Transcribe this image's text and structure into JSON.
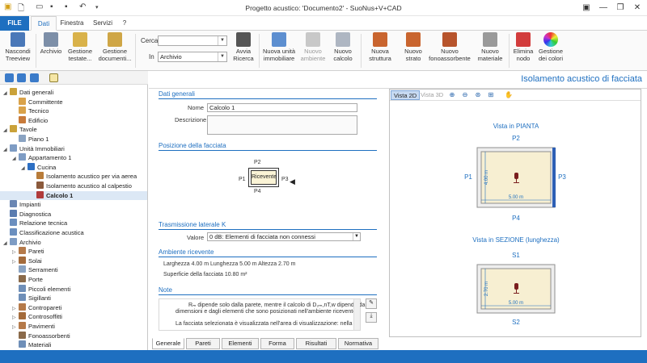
{
  "window": {
    "title": "Progetto acustico: 'Documento2' - SuoNus+V+CAD",
    "minimize": "—",
    "restore": "❐",
    "close": "✕"
  },
  "menu": {
    "file": "FILE",
    "tabs": [
      "Dati",
      "Finestra",
      "Servizi"
    ],
    "help": "?"
  },
  "ribbon": {
    "nascondi": "Nascondi Treeview",
    "archivio": "Archivio",
    "gestione_testate": "Gestione testate...",
    "gestione_documenti": "Gestione documenti...",
    "cerca_label": "Cerca",
    "cerca_value": "",
    "in_label": "In",
    "in_value": "Archivio",
    "avvia": "Avvia Ricerca",
    "nuova_unita": "Nuova unità immobiliare",
    "nuovo_ambiente": "Nuovo ambiente",
    "nuovo_calcolo": "Nuovo calcolo",
    "nuova_struttura": "Nuova struttura",
    "nuovo_strato": "Nuovo strato",
    "nuovo_fono": "Nuovo fonoassorbente",
    "nuovo_materiale": "Nuovo materiale",
    "elimina": "Elimina nodo",
    "gestione_colori": "Gestione dei colori"
  },
  "tree": [
    {
      "label": "Dati generali",
      "level": 0,
      "toggle": "◢",
      "color": "#caa23a"
    },
    {
      "label": "Committente",
      "level": 1,
      "toggle": "",
      "color": "#d9a24a"
    },
    {
      "label": "Tecnico",
      "level": 1,
      "toggle": "",
      "color": "#d9a24a"
    },
    {
      "label": "Edificio",
      "level": 1,
      "toggle": "",
      "color": "#c87a3a"
    },
    {
      "label": "Tavole",
      "level": 0,
      "toggle": "◢",
      "color": "#caa23a"
    },
    {
      "label": "Piano 1",
      "level": 1,
      "toggle": "",
      "color": "#8aa3c2"
    },
    {
      "label": "Unità Immobiliari",
      "level": 0,
      "toggle": "◢",
      "color": "#7e9cc4"
    },
    {
      "label": "Appartamento 1",
      "level": 1,
      "toggle": "◢",
      "color": "#7e9cc4"
    },
    {
      "label": "Cucina",
      "level": 2,
      "toggle": "◢",
      "color": "#2d6fc3"
    },
    {
      "label": "Isolamento acustico per via aerea",
      "level": 3,
      "toggle": "",
      "color": "#b87c3a"
    },
    {
      "label": "Isolamento acustico al calpestio",
      "level": 3,
      "toggle": "",
      "color": "#8b5a3c"
    },
    {
      "label": "Calcolo 1",
      "level": 3,
      "toggle": "",
      "color": "#b03b3b",
      "selected": true,
      "bold": true
    },
    {
      "label": "Impianti",
      "level": 0,
      "toggle": "",
      "color": "#6a86b3"
    },
    {
      "label": "Diagnostica",
      "level": 0,
      "toggle": "",
      "color": "#5a7cb0"
    },
    {
      "label": "Relazione tecnica",
      "level": 0,
      "toggle": "",
      "color": "#6b8fbf"
    },
    {
      "label": "Classificazione acustica",
      "level": 0,
      "toggle": "",
      "color": "#6b8fbf"
    },
    {
      "label": "Archivio",
      "level": 0,
      "toggle": "◢",
      "color": "#7e9cc4"
    },
    {
      "label": "Pareti",
      "level": 1,
      "toggle": "▷",
      "color": "#b57a4a"
    },
    {
      "label": "Solai",
      "level": 1,
      "toggle": "▷",
      "color": "#a46b3b"
    },
    {
      "label": "Serramenti",
      "level": 1,
      "toggle": "",
      "color": "#8aa3c2"
    },
    {
      "label": "Porte",
      "level": 1,
      "toggle": "",
      "color": "#8a6a4a"
    },
    {
      "label": "Piccoli elementi",
      "level": 1,
      "toggle": "",
      "color": "#6f8fb8"
    },
    {
      "label": "Sigillanti",
      "level": 1,
      "toggle": "",
      "color": "#6f8fb8"
    },
    {
      "label": "Contropareti",
      "level": 1,
      "toggle": "▷",
      "color": "#b57a4a"
    },
    {
      "label": "Controsoffitti",
      "level": 1,
      "toggle": "▷",
      "color": "#a46b3b"
    },
    {
      "label": "Pavimenti",
      "level": 1,
      "toggle": "▷",
      "color": "#b57a4a"
    },
    {
      "label": "Fonoassorbenti",
      "level": 1,
      "toggle": "",
      "color": "#8a6a4a"
    },
    {
      "label": "Materiali",
      "level": 1,
      "toggle": "",
      "color": "#6f8fb8"
    }
  ],
  "header": {
    "title": "Isolamento acustico di facciata"
  },
  "form": {
    "sec_dati": "Dati generali",
    "nome_label": "Nome",
    "nome_value": "Calcolo 1",
    "descr_label": "Descrizione",
    "descr_value": "",
    "sec_pos": "Posizione della facciata",
    "pos_p1": "P1",
    "pos_p2": "P2",
    "pos_p3": "P3",
    "pos_p4": "P4",
    "ricevente": "Ricevente",
    "sec_trasm": "Trasmissione laterale K",
    "valore_label": "Valore",
    "valore_value": "0 dB: Elementi di facciata non connessi",
    "sec_amb": "Ambiente ricevente",
    "dims": "Larghezza 4.00 m   Lunghezza 5.00 m   Altezza 2.70 m",
    "superficie": "Superficie della facciata 10.80 m²",
    "sec_note": "Note",
    "note1": "Rₘ dipende solo dalla parete, mentre il calcolo di D₂ₘ,nT,w dipende dalle",
    "note2": "dimensioni e dagli elementi che sono posizionati nell'ambiente ricevente.",
    "note3": "La facciata selezionata è visualizzata nell'area di visualizzazione: nella"
  },
  "bottom_tabs": [
    "Generale",
    "Pareti",
    "Elementi",
    "Forma",
    "Risultati",
    "Normativa"
  ],
  "viewer": {
    "tab2d": "Vista 2D",
    "tab3d": "Vista 3D",
    "pianta_title": "Vista in PIANTA",
    "p1": "P1",
    "p2": "P2",
    "p3": "P3",
    "p4": "P4",
    "dim_v1": "4.00 m",
    "dim_h1": "5.00 m",
    "sezione_title": "Vista in SEZIONE (lunghezza)",
    "s1": "S1",
    "s2": "S2",
    "dim_v2": "2.70 m",
    "dim_h2": "5.00 m",
    "colors": {
      "room_fill": "#f7efd2",
      "room_border": "#8f8f8f",
      "facade": "#2d5fb5",
      "mic": "#7a1e1e"
    }
  }
}
